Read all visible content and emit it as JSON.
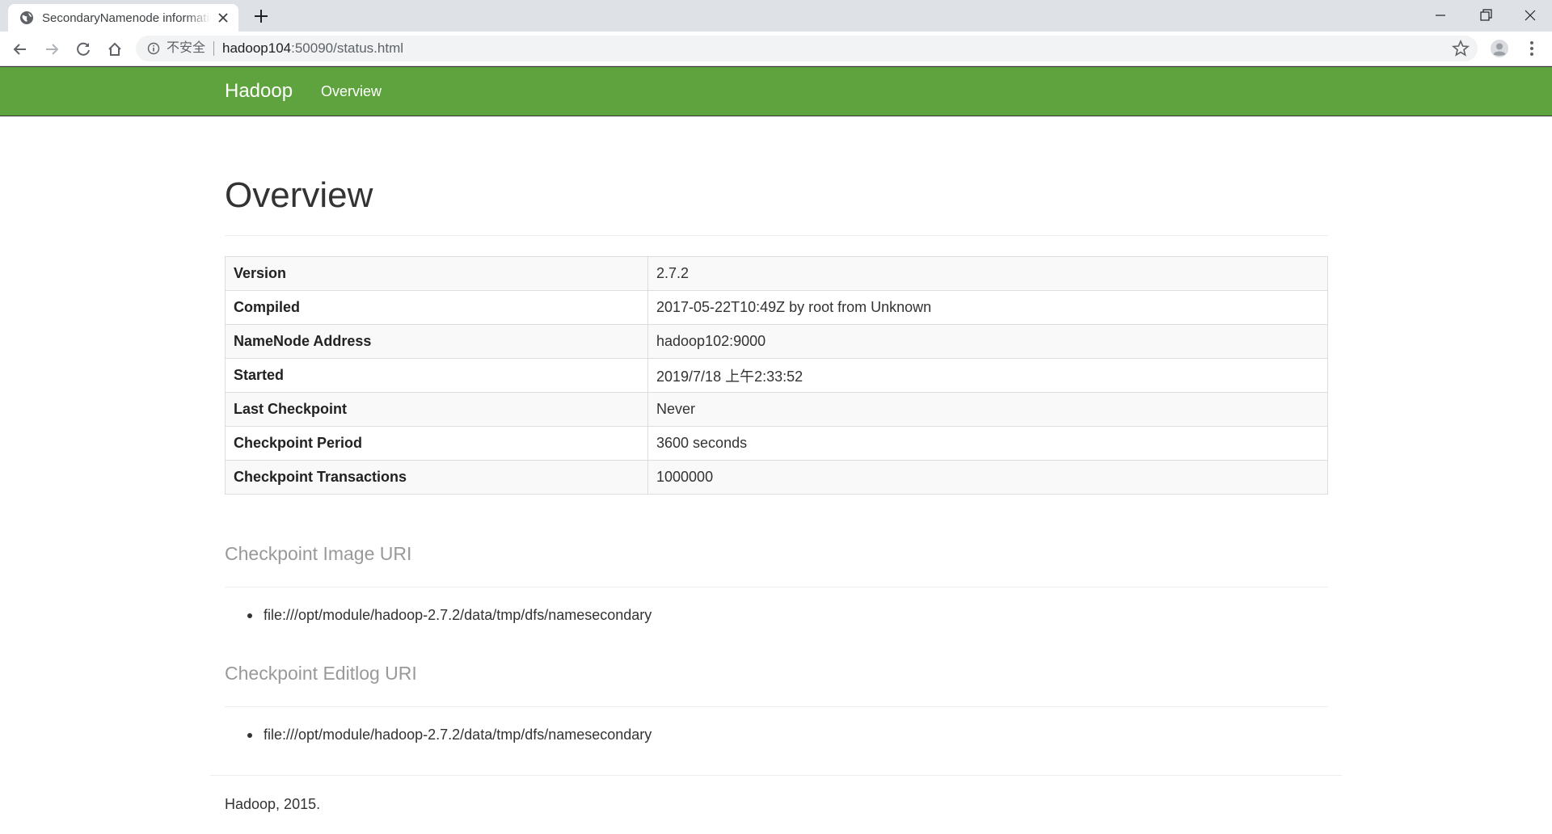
{
  "browser": {
    "tab_title": "SecondaryNamenode information",
    "address_security": "不安全",
    "address_host": "hadoop104",
    "address_path": ":50090/status.html",
    "icons": [
      "globe-icon",
      "close-icon",
      "plus-icon",
      "minimize-icon",
      "restore-icon",
      "window-close-icon",
      "back-icon",
      "forward-icon",
      "reload-icon",
      "home-icon",
      "info-icon",
      "star-icon",
      "profile-icon",
      "menu-icon"
    ]
  },
  "navbar": {
    "brand": "Hadoop",
    "link": "Overview",
    "color": "#5fa33e"
  },
  "overview": {
    "title": "Overview",
    "rows": [
      {
        "key": "Version",
        "value": "2.7.2"
      },
      {
        "key": "Compiled",
        "value": "2017-05-22T10:49Z by root from Unknown"
      },
      {
        "key": "NameNode Address",
        "value": "hadoop102:9000"
      },
      {
        "key": "Started",
        "value": "2019/7/18 上午2:33:52"
      },
      {
        "key": "Last Checkpoint",
        "value": "Never"
      },
      {
        "key": "Checkpoint Period",
        "value": "3600 seconds"
      },
      {
        "key": "Checkpoint Transactions",
        "value": "1000000"
      }
    ]
  },
  "checkpoint_image": {
    "title": "Checkpoint Image URI",
    "uris": [
      "file:///opt/module/hadoop-2.7.2/data/tmp/dfs/namesecondary"
    ]
  },
  "checkpoint_editlog": {
    "title": "Checkpoint Editlog URI",
    "uris": [
      "file:///opt/module/hadoop-2.7.2/data/tmp/dfs/namesecondary"
    ]
  },
  "footer": {
    "text": "Hadoop, 2015."
  }
}
